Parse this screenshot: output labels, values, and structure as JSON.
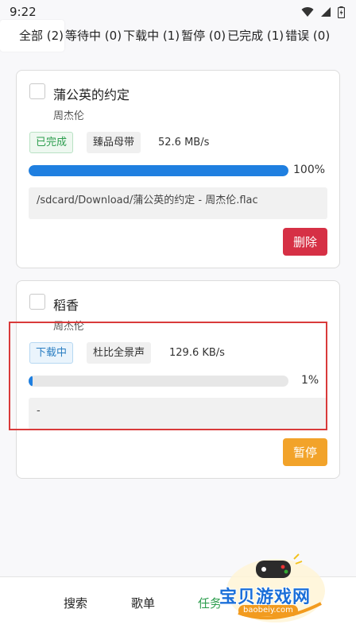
{
  "status": {
    "time": "9:22"
  },
  "tabs": [
    {
      "label": "全部 (2)"
    },
    {
      "label": "等待中 (0)"
    },
    {
      "label": "下载中 (1)"
    },
    {
      "label": "暂停 (0)"
    },
    {
      "label": "已完成 (1)"
    },
    {
      "label": "错误 (0)"
    }
  ],
  "items": [
    {
      "title": "蒲公英的约定",
      "artist": "周杰伦",
      "status": "已完成",
      "quality": "臻品母带",
      "speed": "52.6 MB/s",
      "progress": 100,
      "progress_label": "100%",
      "path": "/sdcard/Download/蒲公英的约定 - 周杰伦.flac",
      "action": "删除"
    },
    {
      "title": "稻香",
      "artist": "周杰伦",
      "status": "下载中",
      "quality": "杜比全景声",
      "speed": "129.6 KB/s",
      "progress": 1,
      "progress_label": "1%",
      "path": "-",
      "action": "暂停"
    }
  ],
  "nav": [
    {
      "label": "搜索"
    },
    {
      "label": "歌单"
    },
    {
      "label": "任务"
    }
  ],
  "watermark": {
    "text": "宝贝游戏网",
    "url": "baobeiy.com"
  },
  "colors": {
    "progress": "#1f7fe0",
    "delete": "#d63045",
    "pause": "#f2a32a",
    "done": "#2e9e4f",
    "downloading": "#2a7ec2"
  }
}
